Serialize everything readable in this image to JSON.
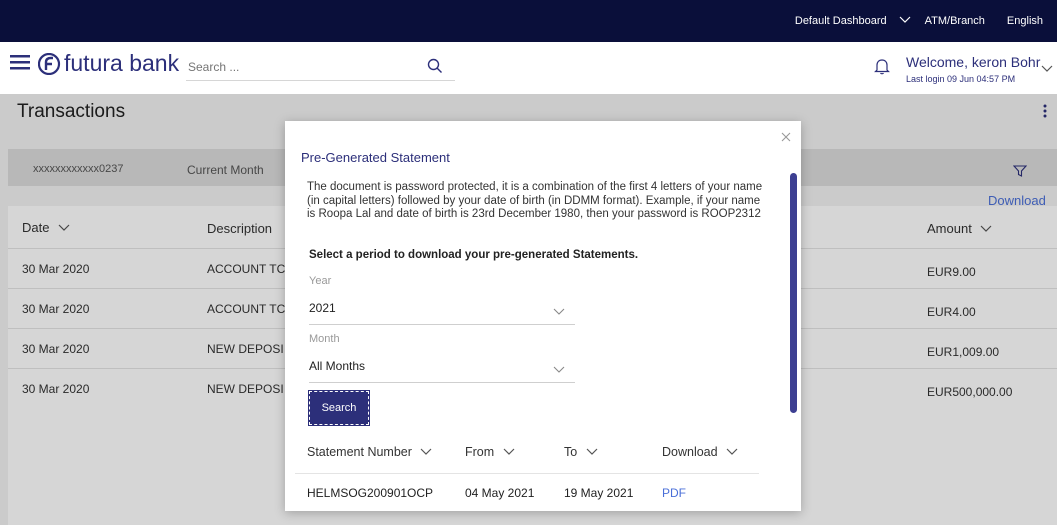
{
  "topbar": {
    "dashboard_label": "Default Dashboard",
    "atm_label": "ATM/Branch",
    "language_label": "English"
  },
  "header": {
    "brand": "futura bank",
    "search_placeholder": "Search ...",
    "welcome": "Welcome, keron Bohr",
    "last_login": "Last login 09 Jun 04:57 PM"
  },
  "page": {
    "title": "Transactions",
    "filter": {
      "account": "xxxxxxxxxxxx0237",
      "period": "Current Month"
    },
    "download_link": "Download",
    "columns": {
      "date": "Date",
      "description": "Description",
      "amount": "Amount"
    },
    "rows": [
      {
        "date": "30 Mar 2020",
        "description": "ACCOUNT TC",
        "amount": "EUR9.00"
      },
      {
        "date": "30 Mar 2020",
        "description": "ACCOUNT TC",
        "amount": "EUR4.00"
      },
      {
        "date": "30 Mar 2020",
        "description": "NEW DEPOSI",
        "amount": "EUR1,009.00"
      },
      {
        "date": "30 Mar 2020",
        "description": "NEW DEPOSI",
        "amount": "EUR500,000.00"
      }
    ]
  },
  "modal": {
    "title": "Pre-Generated Statement",
    "description": "The document is password protected, it is a combination of the first 4 letters of your name (in capital letters) followed by your date of birth (in DDMM format). Example, if your name is Roopa Lal and date of birth is 23rd December 1980, then your password is ROOP2312",
    "instruction": "Select a period to download your pre-generated Statements.",
    "year_label": "Year",
    "year_value": "2021",
    "month_label": "Month",
    "month_value": "All Months",
    "search_button": "Search",
    "columns": {
      "statement": "Statement Number",
      "from": "From",
      "to": "To",
      "download": "Download"
    },
    "statements": [
      {
        "number": "HELMSOG200901OCP",
        "from": "04 May 2021",
        "to": "19 May 2021",
        "download": "PDF"
      }
    ]
  },
  "colors": {
    "topbar": "#0a0f3a",
    "accent": "#2c2f7a",
    "link": "#4a6fd8"
  }
}
